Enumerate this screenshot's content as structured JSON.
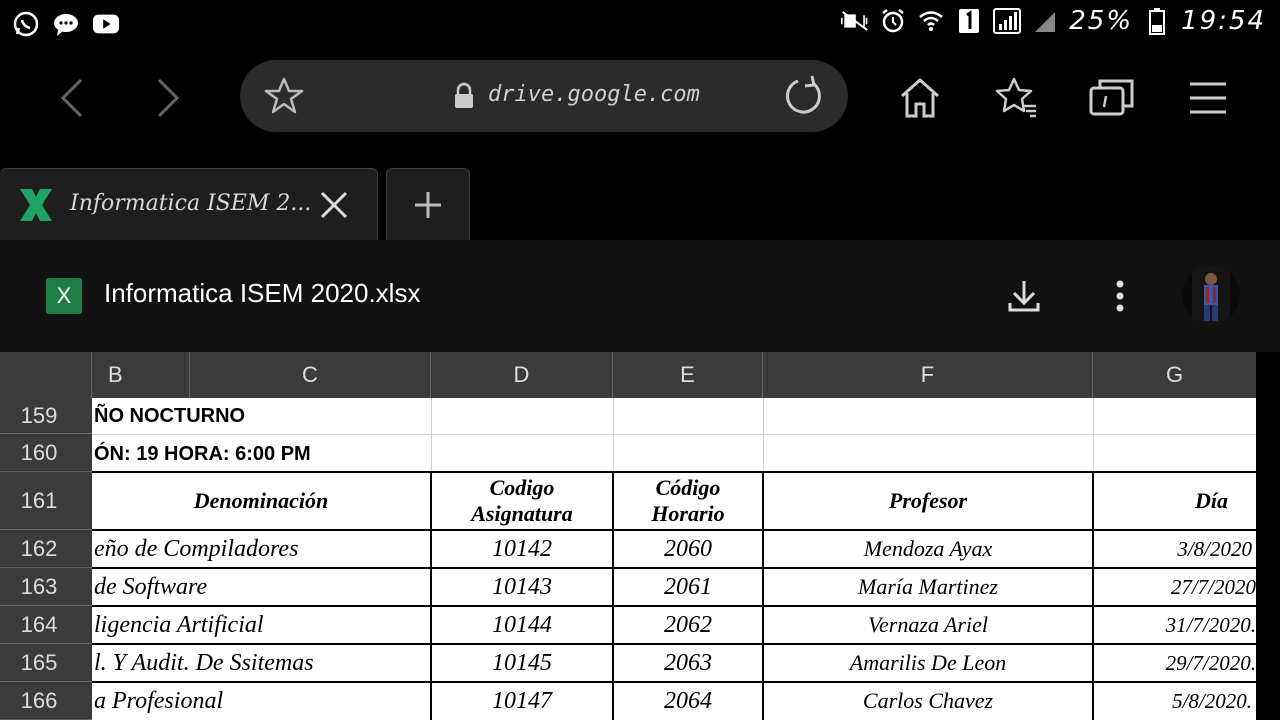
{
  "status_bar": {
    "battery": "25%",
    "time": "19:54",
    "left_icons": [
      "whatsapp-icon",
      "chat-icon",
      "youtube-icon"
    ],
    "right_icons": [
      "mute-icon",
      "alarm-icon",
      "wifi-icon",
      "sim1-icon",
      "signal-icon",
      "signal2-icon",
      "battery-icon"
    ]
  },
  "toolbar": {
    "url": "drive.google.com",
    "icons": [
      "back-icon",
      "forward-icon",
      "bookmark-star-icon",
      "lock-icon",
      "reload-icon",
      "home-icon",
      "bookmarks-icon",
      "tabs-icon",
      "menu-icon"
    ]
  },
  "tabs": {
    "active_label": "Informatica ISEM 2...",
    "new_tab": "+"
  },
  "drive": {
    "badge": "X",
    "file_title": "Informatica ISEM 2020.xlsx"
  },
  "sheet": {
    "columns": [
      "B",
      "C",
      "D",
      "E",
      "F",
      "G"
    ],
    "row_numbers": [
      "159",
      "160",
      "161",
      "162",
      "163",
      "164",
      "165",
      "166"
    ],
    "row159": "ÑO  NOCTURNO",
    "row160": "ÓN: 19    HORA: 6:00 PM",
    "headers": {
      "denominacion": "Denominación",
      "codigo_asig_1": "Codigo",
      "codigo_asig_2": "Asignatura",
      "codigo_hor_1": "Código",
      "codigo_hor_2": "Horario",
      "profesor": "Profesor",
      "dia": "Día"
    },
    "rows": [
      {
        "denominacion": "eño de Compiladores",
        "asignatura": "10142",
        "horario": "2060",
        "profesor": "Mendoza Ayax",
        "dia": "3/8/2020"
      },
      {
        "denominacion": "de Software",
        "asignatura": "10143",
        "horario": "2061",
        "profesor": "María Martinez",
        "dia": "27/7/2020"
      },
      {
        "denominacion": "ligencia Artificial",
        "asignatura": "10144",
        "horario": "2062",
        "profesor": "Vernaza Ariel",
        "dia": "31/7/2020."
      },
      {
        "denominacion": "l. Y Audit. De Ssitemas",
        "asignatura": "10145",
        "horario": "2063",
        "profesor": "Amarilis De Leon",
        "dia": "29/7/2020."
      },
      {
        "denominacion": "a Profesional",
        "asignatura": "10147",
        "horario": "2064",
        "profesor": "Carlos Chavez",
        "dia": "5/8/2020."
      }
    ]
  }
}
